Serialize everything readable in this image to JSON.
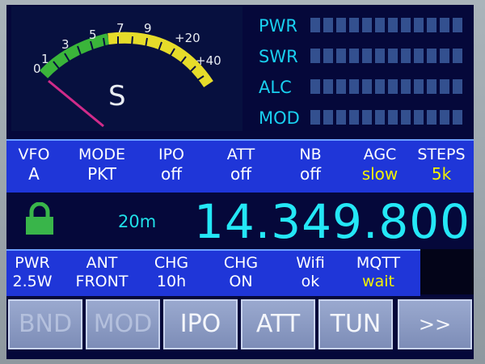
{
  "meter": {
    "letter": "S",
    "scale": [
      "0",
      "1",
      "3",
      "5",
      "7",
      "9",
      "+20",
      "+40"
    ]
  },
  "bars": [
    {
      "label": "PWR"
    },
    {
      "label": "SWR"
    },
    {
      "label": "ALC"
    },
    {
      "label": "MOD"
    }
  ],
  "status": [
    {
      "head": "VFO",
      "value": "A",
      "highlight": false
    },
    {
      "head": "MODE",
      "value": "PKT",
      "highlight": false
    },
    {
      "head": "IPO",
      "value": "off",
      "highlight": false
    },
    {
      "head": "ATT",
      "value": "off",
      "highlight": false
    },
    {
      "head": "NB",
      "value": "off",
      "highlight": false
    },
    {
      "head": "AGC",
      "value": "slow",
      "highlight": true
    },
    {
      "head": "STEPS",
      "value": "5k",
      "highlight": true
    }
  ],
  "frequency": {
    "band": "20m",
    "value": "14.349.800",
    "lock_icon": "lock-icon"
  },
  "info": [
    {
      "head": "PWR",
      "value": "2.5W",
      "highlight": false
    },
    {
      "head": "ANT",
      "value": "FRONT",
      "highlight": false
    },
    {
      "head": "CHG",
      "value": "10h",
      "highlight": false
    },
    {
      "head": "CHG",
      "value": "ON",
      "highlight": false
    },
    {
      "head": "Wifi",
      "value": "ok",
      "highlight": false
    },
    {
      "head": "MQTT",
      "value": "wait",
      "highlight": true
    }
  ],
  "buttons": [
    {
      "label": "BND",
      "enabled": false
    },
    {
      "label": "MOD",
      "enabled": false
    },
    {
      "label": "IPO",
      "enabled": true
    },
    {
      "label": "ATT",
      "enabled": true
    },
    {
      "label": "TUN",
      "enabled": true
    },
    {
      "label": ">>",
      "enabled": true
    }
  ],
  "colors": {
    "screen_bg": "#05083a",
    "panel_blue": "#1f36d8",
    "cyan": "#24e7f6",
    "yellow": "#f3f200",
    "lock_green": "#39b54a"
  }
}
